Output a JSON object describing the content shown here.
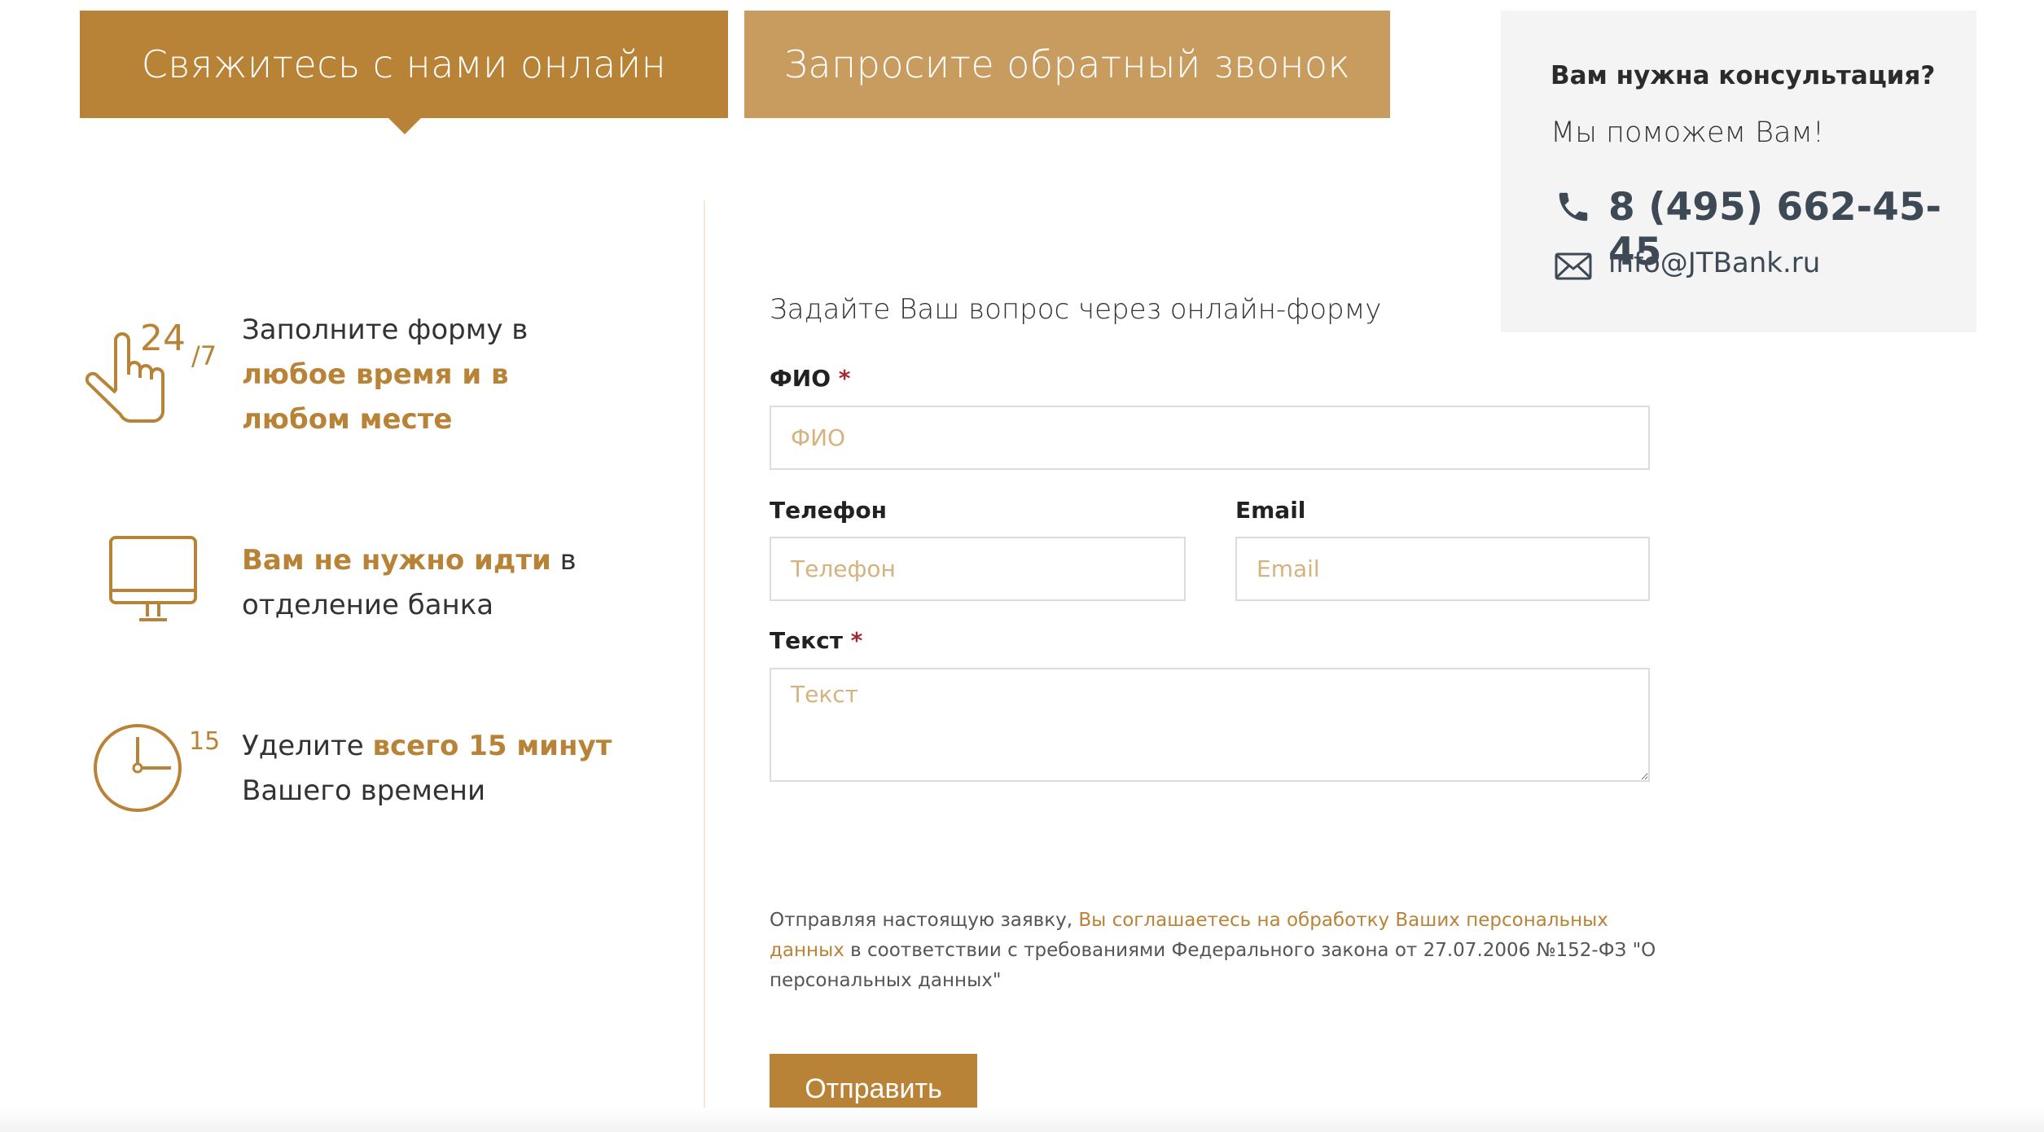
{
  "tabs": [
    {
      "label": "Свяжитесь с нами онлайн",
      "active": true
    },
    {
      "label": "Запросите обратный звонок",
      "active": false
    }
  ],
  "consult": {
    "title": "Вам нужна консультация?",
    "subtitle": "Мы поможем Вам!",
    "phone": "8 (495) 662-45-45",
    "email": "info@JTBank.ru"
  },
  "features": [
    {
      "icon": "hand-24-7-icon",
      "badge_main": "24",
      "badge_sub": "/7",
      "pre": "Заполните форму в ",
      "highlight": "любое время и в любом месте",
      "post": ""
    },
    {
      "icon": "monitor-icon",
      "pre": "",
      "highlight": "Вам не нужно идти",
      "post": " в отделение банка"
    },
    {
      "icon": "clock-icon",
      "badge_main": "15",
      "pre": "Уделите ",
      "highlight": "всего 15 минут",
      "post": " Вашего времени"
    }
  ],
  "form": {
    "heading": "Задайте Ваш вопрос через онлайн-форму",
    "required_mark": "*",
    "fio": {
      "label": "ФИО",
      "placeholder": "ФИО",
      "value": ""
    },
    "phone": {
      "label": "Телефон",
      "placeholder": "Телефон",
      "value": ""
    },
    "email": {
      "label": "Email",
      "placeholder": "Email",
      "value": ""
    },
    "text": {
      "label": "Текст",
      "placeholder": "Текст",
      "value": ""
    },
    "consent_pre": "Отправляя настоящую заявку, ",
    "consent_link": "Вы соглашаетесь на обработку Ваших персональных данных",
    "consent_post": " в соответствии с требованиями Федерального закона от 27.07.2006 №152-ФЗ \"О персональных данных\"",
    "submit_label": "Отправить"
  },
  "colors": {
    "accent": "#b98337",
    "accent_light": "#c89c5f",
    "panel": "#f4f4f4",
    "required": "#a8282c"
  }
}
